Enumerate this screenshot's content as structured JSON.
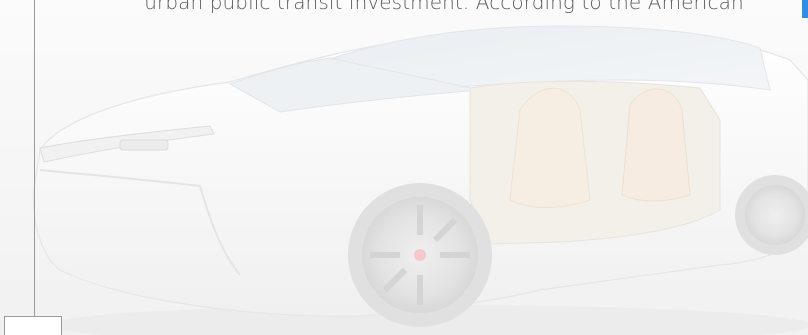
{
  "article": {
    "paragraph_line": "urban public transit investment. According to the American"
  },
  "colors": {
    "accent": "#2f8fe8",
    "rule": "#9a9a9a",
    "text": "#5b5b5b"
  },
  "icons": {
    "hero": "concept-electric-car-image"
  }
}
